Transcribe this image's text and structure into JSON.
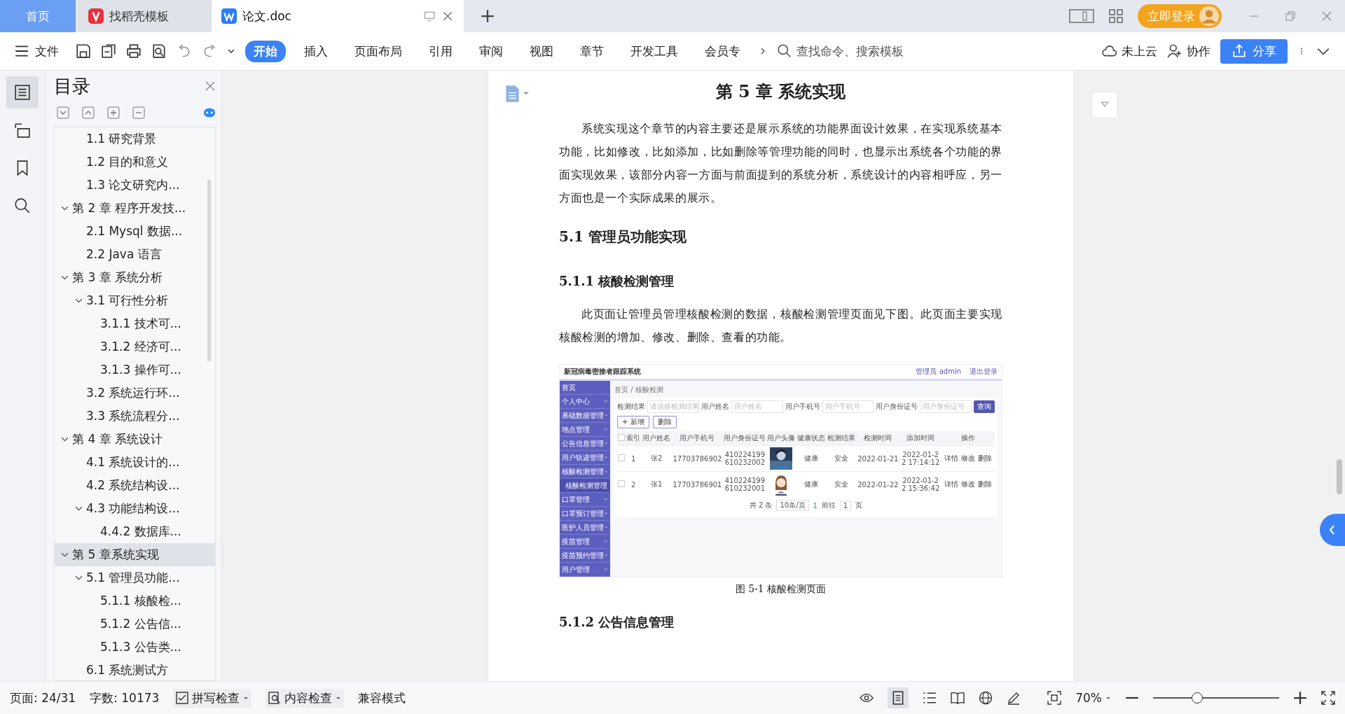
{
  "tabs": [
    {
      "label": "首页",
      "kind": "home",
      "selected": false
    },
    {
      "label": "找稻壳模板",
      "kind": "docer",
      "selected": false
    },
    {
      "label": "论文.doc",
      "kind": "doc",
      "selected": true
    }
  ],
  "login_button": "立即登录",
  "menu": {
    "file": "文件",
    "ribbon_tabs": [
      {
        "label": "开始",
        "selected": true
      },
      {
        "label": "插入",
        "selected": false
      },
      {
        "label": "页面布局",
        "selected": false
      },
      {
        "label": "引用",
        "selected": false
      },
      {
        "label": "审阅",
        "selected": false
      },
      {
        "label": "视图",
        "selected": false
      },
      {
        "label": "章节",
        "selected": false
      },
      {
        "label": "开发工具",
        "selected": false
      },
      {
        "label": "会员专",
        "selected": false
      }
    ],
    "search": {
      "placeholder": "查找命令、搜索模板"
    },
    "cloud": "未上云",
    "collab": "协作",
    "share": "分享"
  },
  "toc": {
    "title": "目录",
    "items": [
      {
        "children": [
          {
            "label": "1.1  研究背景",
            "selected": false
          },
          {
            "label": "1.2 目的和意义",
            "selected": false
          },
          {
            "label": "1.3  论文研究内...",
            "selected": false
          }
        ]
      },
      {
        "label": "第 2 章  程序开发技...",
        "selected": false,
        "expanded": true,
        "children": [
          {
            "label": "2.1 Mysql 数据...",
            "selected": false
          },
          {
            "label": "2.2 Java 语言",
            "selected": false
          }
        ]
      },
      {
        "label": "第 3 章  系统分析",
        "selected": false,
        "expanded": true,
        "children": [
          {
            "label": "3.1 可行性分析",
            "selected": false,
            "expanded": true,
            "children": [
              {
                "label": "3.1.1 技术可...",
                "selected": false
              },
              {
                "label": "3.1.2 经济可...",
                "selected": false
              },
              {
                "label": "3.1.3 操作可...",
                "selected": false
              }
            ]
          },
          {
            "label": "3.2 系统运行环...",
            "selected": false
          },
          {
            "label": "3.3 系统流程分...",
            "selected": false
          }
        ]
      },
      {
        "label": "第 4 章  系统设计",
        "selected": false,
        "expanded": true,
        "children": [
          {
            "label": "4.1  系统设计的...",
            "selected": false
          },
          {
            "label": "4.2  系统结构设...",
            "selected": false
          },
          {
            "label": "4.3 功能结构设...",
            "selected": false,
            "expanded": true,
            "children": [
              {
                "label": "4.4.2  数据库...",
                "selected": false
              }
            ]
          }
        ]
      },
      {
        "label": "第 5 章系统实现",
        "selected": true,
        "expanded": true,
        "children": [
          {
            "label": "5.1 管理员功能...",
            "selected": false,
            "expanded": true,
            "children": [
              {
                "label": "5.1.1  核酸检...",
                "selected": false
              },
              {
                "label": "5.1.2  公告信...",
                "selected": false
              },
              {
                "label": "5.1.3 公告类...",
                "selected": false
              }
            ]
          },
          {
            "label": "6.1 系统测试方",
            "selected": false
          }
        ]
      }
    ]
  },
  "document": {
    "chapter_title": "第 5 章 系统实现",
    "intro": "系统实现这个章节的内容主要还是展示系统的功能界面设计效果，在实现系统基本功能，比如修改，比如添加，比如删除等管理功能的同时，也显示出系统各个功能的界面实现效果，该部分内容一方面与前面提到的系统分析，系统设计的内容相呼应，另一方面也是一个实际成果的展示。",
    "section_title": "5.1 管理员功能实现",
    "subsection_title": "5.1.1  核酸检测管理",
    "subsection_text": "此页面让管理员管理核酸检测的数据，核酸检测管理页面见下图。此页面主要实现核酸检测的增加、修改、删除、查看的功能。",
    "figure": {
      "app": {
        "title": "新冠病毒密接者跟踪系统",
        "user": "管理员 admin",
        "logout": "退出登录",
        "sidebar": [
          {
            "label": "首页",
            "kind": "link"
          },
          {
            "label": "个人中心",
            "kind": "group",
            "expanded": false
          },
          {
            "label": "基础数据管理",
            "kind": "group",
            "expanded": false
          },
          {
            "label": "地点管理",
            "kind": "group",
            "expanded": false
          },
          {
            "label": "公告信息管理",
            "kind": "group",
            "expanded": false
          },
          {
            "label": "用户轨迹管理",
            "kind": "group",
            "expanded": false
          },
          {
            "label": "核酸检测管理",
            "kind": "group",
            "expanded": true
          },
          {
            "label": "核酸检测管理",
            "kind": "sub"
          },
          {
            "label": "口罩管理",
            "kind": "group",
            "expanded": false
          },
          {
            "label": "口罩预订管理",
            "kind": "group",
            "expanded": false
          },
          {
            "label": "医护人员管理",
            "kind": "group",
            "expanded": false
          },
          {
            "label": "疫苗管理",
            "kind": "group",
            "expanded": false
          },
          {
            "label": "疫苗预约管理",
            "kind": "group",
            "expanded": false
          },
          {
            "label": "用户管理",
            "kind": "group",
            "expanded": false
          }
        ],
        "breadcrumb": "首页 / 核酸检测",
        "filters": [
          {
            "label": "检测结果",
            "placeholder": "请选择检测结果"
          },
          {
            "label": "用户姓名",
            "placeholder": "用户姓名"
          },
          {
            "label": "用户手机号",
            "placeholder": "用户手机号"
          },
          {
            "label": "用户身份证号",
            "placeholder": "用户身份证号"
          }
        ],
        "query_button": "查询",
        "add_button": "+ 新增",
        "delete_button": "删除",
        "select_all_checked": false,
        "columns": [
          "索引",
          "用户姓名",
          "用户手机号",
          "用户身份证号",
          "用户头像",
          "健康状态",
          "检测结果",
          "检测时间",
          "添加时间",
          "操作"
        ],
        "rows": [
          {
            "checked": false,
            "index": "1",
            "name": "张2",
            "phone": "17703786902",
            "id_number": "410224199610232002",
            "health": "健康",
            "result": "安全",
            "test_time": "2022-01-21",
            "added_time": "2022-01-22 17:14:12",
            "actions": [
              "详情",
              "修改",
              "删除"
            ]
          },
          {
            "checked": false,
            "index": "2",
            "name": "张1",
            "phone": "17703786901",
            "id_number": "410224199610232001",
            "health": "健康",
            "result": "安全",
            "test_time": "2022-01-22",
            "added_time": "2022-01-22 15:36:42",
            "actions": [
              "详情",
              "修改",
              "删除"
            ]
          }
        ],
        "pagination": {
          "total": "共 2 条",
          "page_size": "10条/页",
          "current": "1",
          "goto": "前往",
          "goto_value": "1",
          "unit": "页"
        }
      },
      "caption": "图 5-1  核酸检测页面"
    },
    "next_title": "5.1.2  公告信息管理"
  },
  "status_bar": {
    "page": "页面: 24/31",
    "words": "字数: 10173",
    "spell": "拼写检查",
    "content_check": "内容检查",
    "mode": "兼容模式",
    "zoom": "70%",
    "zoom_slider": {
      "level": 0.35
    }
  }
}
